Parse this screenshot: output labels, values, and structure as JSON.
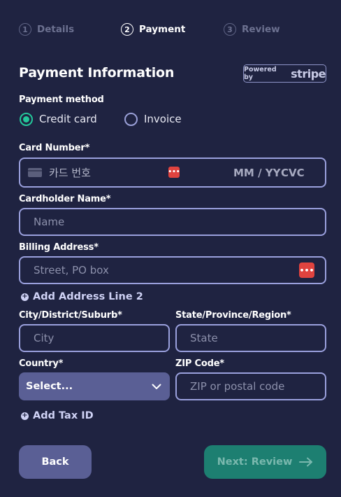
{
  "stepper": [
    {
      "number": "1",
      "label": "Details"
    },
    {
      "number": "2",
      "label": "Payment"
    },
    {
      "number": "3",
      "label": "Review"
    }
  ],
  "active_step": 2,
  "title": "Payment Information",
  "stripe_badge": {
    "powered_by": "Powered by",
    "brand": "stripe"
  },
  "payment_method": {
    "label": "Payment method",
    "options": [
      "Credit card",
      "Invoice"
    ],
    "selected": "Credit card"
  },
  "card_number": {
    "label": "Card Number*",
    "placeholder": "카드 번호",
    "expiry_placeholder": "MM / YY",
    "cvc_placeholder": "CVC"
  },
  "cardholder": {
    "label": "Cardholder Name*",
    "placeholder": "Name"
  },
  "billing": {
    "label": "Billing Address*",
    "placeholder": "Street, PO box"
  },
  "add_address_line": "Add Address Line 2",
  "city": {
    "label": "City/District/Suburb*",
    "placeholder": "City"
  },
  "state": {
    "label": "State/Province/Region*",
    "placeholder": "State"
  },
  "country": {
    "label": "Country*",
    "value": "Select..."
  },
  "zip": {
    "label": "ZIP Code*",
    "placeholder": "ZIP or postal code"
  },
  "add_tax_id": "Add Tax ID",
  "buttons": {
    "back": "Back",
    "next": "Next: Review"
  },
  "colors": {
    "background": "#1f2341",
    "accent_green": "#24c79a",
    "field_border": "#9aa0dd",
    "primary_button": "#1d7f71",
    "secondary_button": "#5a5f95",
    "autofill_icon": "#e0433f"
  },
  "icons": {
    "card": "card-icon",
    "autofill": "password-manager-icon",
    "plus": "plus-circle-icon",
    "chevron": "chevron-down-icon",
    "arrow": "arrow-right-icon"
  }
}
